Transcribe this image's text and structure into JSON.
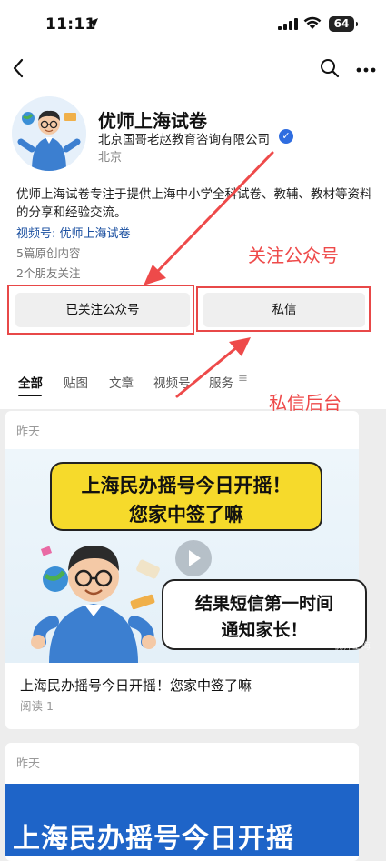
{
  "status_bar": {
    "time": "11:11",
    "battery": "64"
  },
  "profile": {
    "name": "优师上海试卷",
    "company": "北京国哥老赵教育咨询有限公司",
    "city": "北京",
    "description": "优师上海试卷专注于提供上海中小学全科试卷、教辅、教材等资料的分享和经验交流。",
    "channel": "视频号: 优师上海试卷",
    "original_count": "5篇原创内容",
    "friends_following": "2个朋友关注"
  },
  "buttons": {
    "follow": "已关注公众号",
    "message": "私信"
  },
  "tabs": [
    {
      "label": "全部",
      "active": true
    },
    {
      "label": "贴图"
    },
    {
      "label": "文章"
    },
    {
      "label": "视频号"
    },
    {
      "label": "服务"
    }
  ],
  "tab_menu_glyph": "≡",
  "posts": [
    {
      "date": "昨天",
      "thumb_line1": "上海民办摇号今日开摇！",
      "thumb_line2": "您家中签了嘛",
      "thumb_line3": "结果短信第一时间",
      "thumb_line4": "通知家长！",
      "watermark": "优师上海",
      "title": "上海民办摇号今日开摇！您家中签了嘛",
      "reads": "阅读 1"
    },
    {
      "date": "昨天",
      "thumb_text": "上海民办摇号今日开摇"
    }
  ],
  "annotations": {
    "follow_label": "关注公众号",
    "message_label": "私信后台"
  },
  "colors": {
    "annotation_red": "#ee4a4a",
    "link_blue": "#1a4fa0",
    "verify_blue": "#2f6de0",
    "banner_yellow": "#f6da2b"
  }
}
